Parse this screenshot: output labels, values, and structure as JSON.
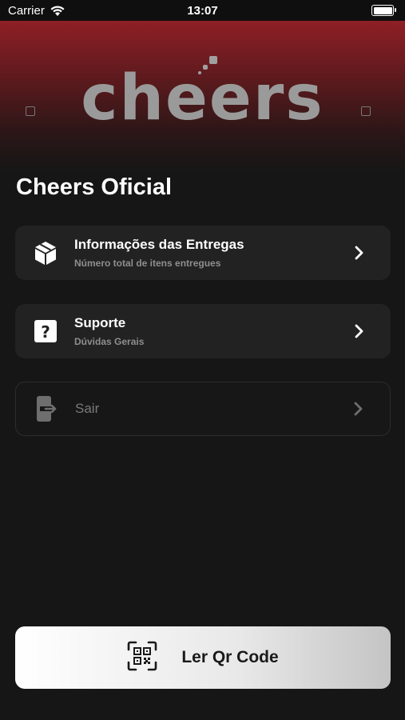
{
  "status_bar": {
    "carrier": "Carrier",
    "time": "13:07"
  },
  "brand": {
    "logo_text": "cheers"
  },
  "page": {
    "title": "Cheers Oficial"
  },
  "menu": [
    {
      "title": "Informações das Entregas",
      "subtitle": "Número total de itens entregues",
      "icon": "box-icon",
      "enabled": true
    },
    {
      "title": "Suporte",
      "subtitle": "Dúvidas Gerais",
      "icon": "question-icon",
      "enabled": true
    },
    {
      "title": "Sair",
      "subtitle": "",
      "icon": "logout-icon",
      "enabled": false
    }
  ],
  "qr_button": {
    "label": "Ler Qr Code",
    "icon": "qr-scan-icon"
  },
  "colors": {
    "accent": "#8f1f26",
    "background": "#161616",
    "card": "#222223"
  }
}
